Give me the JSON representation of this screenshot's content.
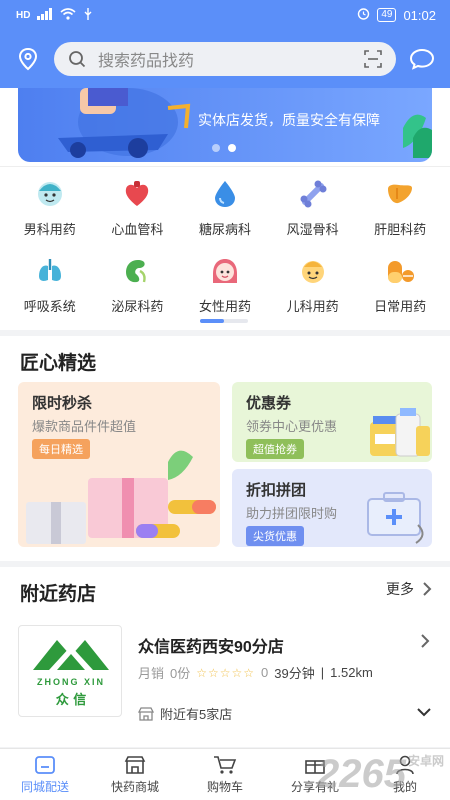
{
  "status": {
    "time": "01:02",
    "battery": "49",
    "network": "HD"
  },
  "search": {
    "placeholder": "搜索药品找药"
  },
  "banner": {
    "text": "实体店发货，质量安全有保障"
  },
  "categories": [
    {
      "label": "男科用药",
      "icon": "man-face-icon",
      "color": "#3fb2c8"
    },
    {
      "label": "心血管科",
      "icon": "heart-icon",
      "color": "#e8484f"
    },
    {
      "label": "糖尿病科",
      "icon": "blood-drop-icon",
      "color": "#3a8ee6"
    },
    {
      "label": "风湿骨科",
      "icon": "bone-icon",
      "color": "#6f7fd8"
    },
    {
      "label": "肝胆科药",
      "icon": "liver-icon",
      "color": "#f3a32e"
    },
    {
      "label": "呼吸系统",
      "icon": "lungs-icon",
      "color": "#48b3d9"
    },
    {
      "label": "泌尿科药",
      "icon": "kidney-icon",
      "color": "#4caf50"
    },
    {
      "label": "女性用药",
      "icon": "woman-face-icon",
      "color": "#e9687a"
    },
    {
      "label": "儿科用药",
      "icon": "child-face-icon",
      "color": "#f5b43c"
    },
    {
      "label": "日常用药",
      "icon": "pills-icon",
      "color": "#f39a2b"
    }
  ],
  "featured": {
    "title": "匠心精选",
    "cards": [
      {
        "title": "限时秒杀",
        "subtitle": "爆款商品件件超值",
        "tag": "每日精选",
        "tag_color": "#f5a25d"
      },
      {
        "title": "优惠券",
        "subtitle": "领券中心更优惠",
        "tag": "超值抢券",
        "tag_color": "#8fbf5a"
      },
      {
        "title": "折扣拼团",
        "subtitle": "助力拼团限时购",
        "tag": "尖货优惠",
        "tag_color": "#6f8ff0"
      }
    ]
  },
  "nearby": {
    "title": "附近药店",
    "more": "更多",
    "store": {
      "name": "众信医药西安90分店",
      "logo_top": "ZHONG XIN",
      "logo_bottom": "众 信",
      "sales_label": "月销",
      "sales": "0份",
      "rating": "0",
      "time": "39分钟",
      "distance": "1.52km",
      "nearby_count": "附近有5家店"
    }
  },
  "nav": {
    "tabs": [
      {
        "label": "同城配送",
        "icon": "home-icon",
        "active": true
      },
      {
        "label": "快药商城",
        "icon": "store-icon",
        "active": false
      },
      {
        "label": "购物车",
        "icon": "cart-icon",
        "active": false
      },
      {
        "label": "分享有礼",
        "icon": "gift-icon",
        "active": false
      },
      {
        "label": "我的",
        "icon": "user-icon",
        "active": false
      }
    ]
  },
  "watermark": {
    "text": "2265",
    "suffix": "安卓网"
  }
}
